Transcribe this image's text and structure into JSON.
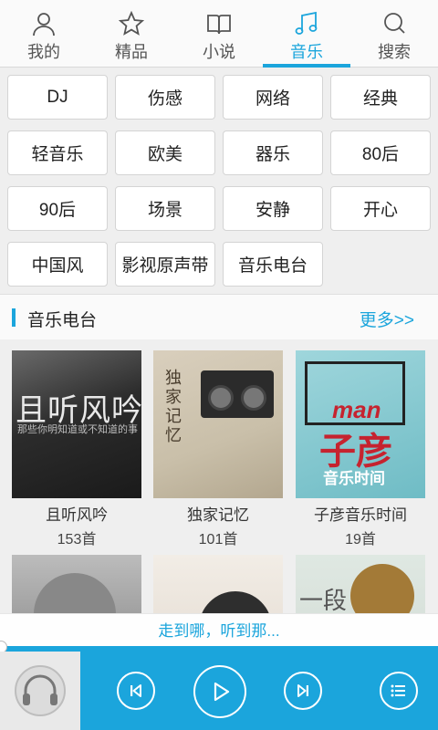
{
  "tabs": [
    {
      "label": "我的",
      "icon": "user-icon"
    },
    {
      "label": "精品",
      "icon": "star-icon"
    },
    {
      "label": "小说",
      "icon": "book-icon"
    },
    {
      "label": "音乐",
      "icon": "music-note-icon"
    },
    {
      "label": "搜索",
      "icon": "search-icon"
    }
  ],
  "active_tab": "音乐",
  "categories": [
    "DJ",
    "伤感",
    "网络",
    "经典",
    "轻音乐",
    "欧美",
    "器乐",
    "80后",
    "90后",
    "场景",
    "安静",
    "开心",
    "中国风",
    "影视原声带",
    "音乐电台"
  ],
  "section": {
    "title": "音乐电台",
    "more": "更多>>"
  },
  "albums": [
    {
      "name": "且听风吟",
      "count": "153首",
      "cover_title": "且听风吟",
      "cover_sub": "那些你明知道或不知道的事"
    },
    {
      "name": "独家记忆",
      "count": "101首",
      "cover_title": "独家记忆"
    },
    {
      "name": "子彦音乐时间",
      "count": "19首",
      "cover_brand": "man",
      "cover_title": "子彦",
      "cover_band": "音乐时间"
    },
    {
      "name": "",
      "count": ""
    },
    {
      "name": "",
      "count": ""
    },
    {
      "name": "",
      "count": "",
      "cover_title": "一段"
    }
  ],
  "now_playing": "走到哪，听到那...",
  "colors": {
    "accent": "#1ba5dc",
    "background": "#efefef"
  }
}
